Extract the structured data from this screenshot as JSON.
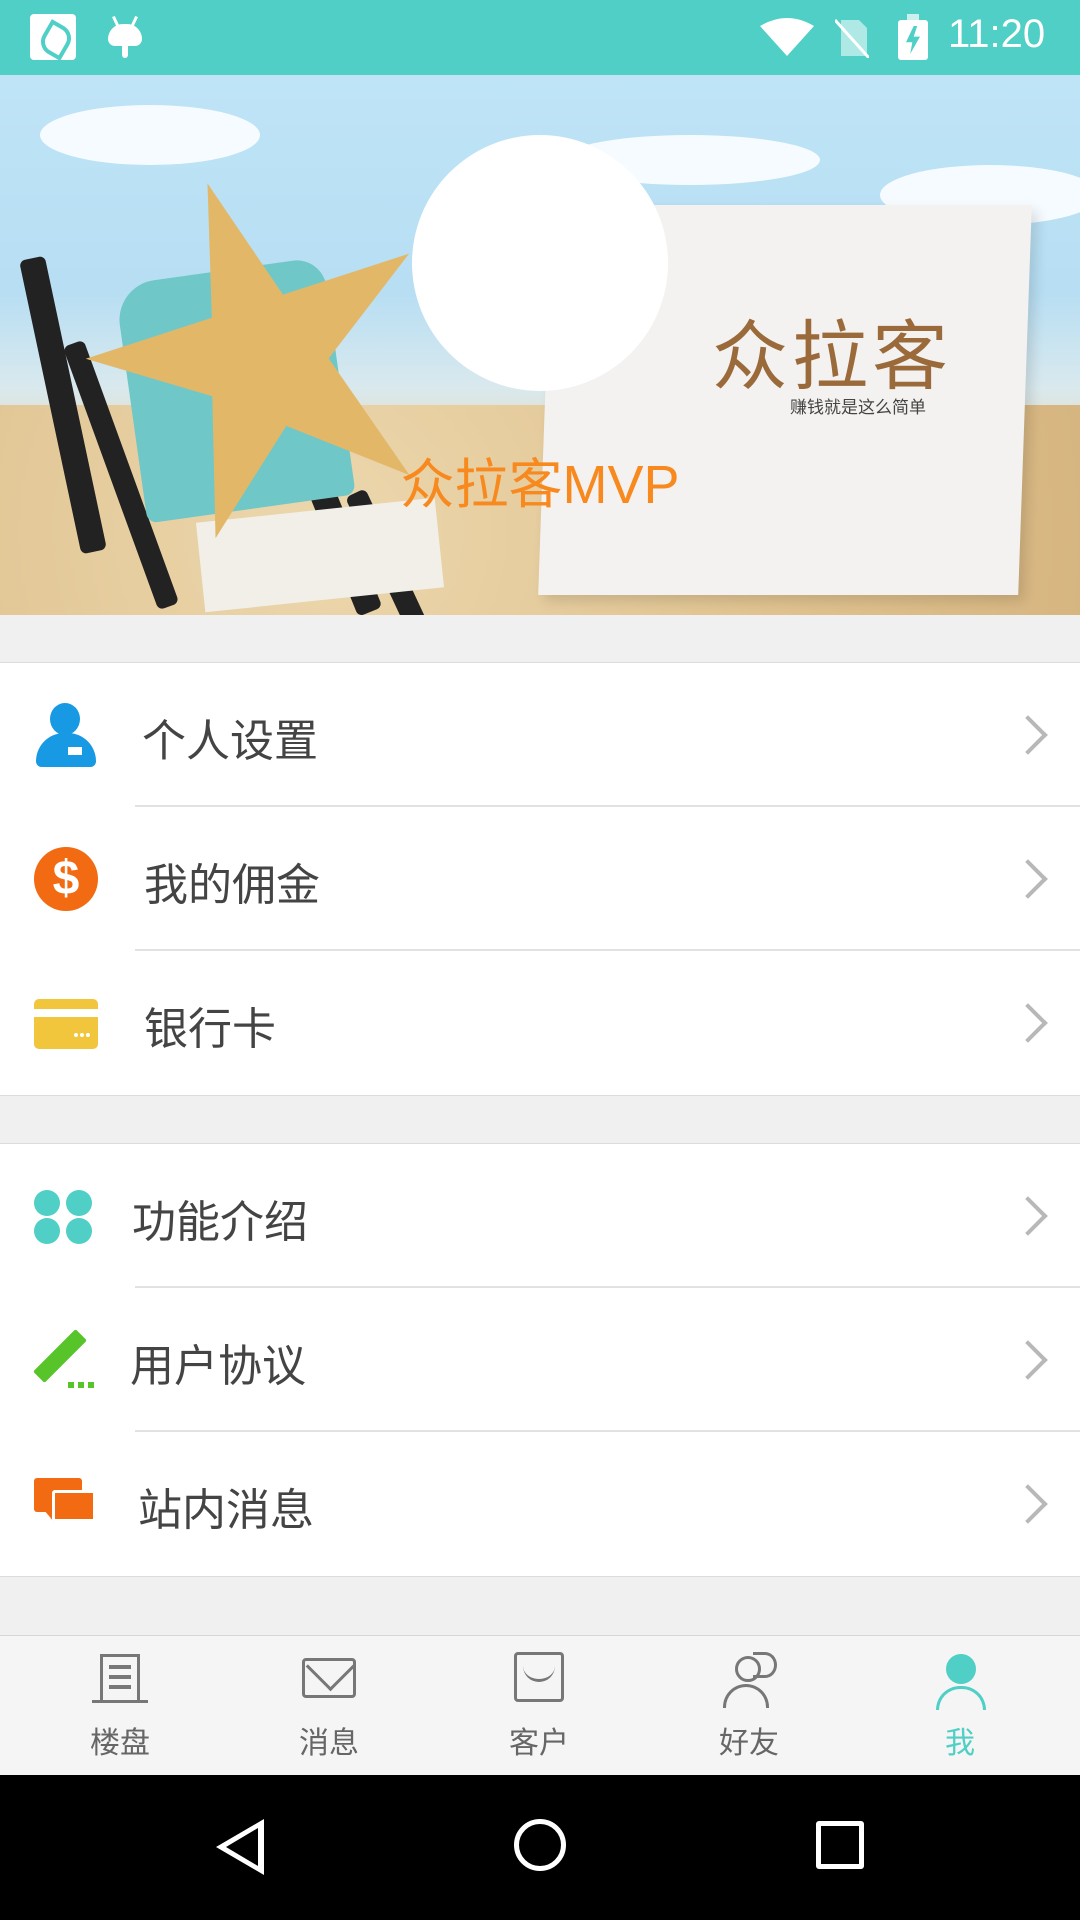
{
  "status_bar": {
    "time": "11:20",
    "icons": [
      "app-notification-icon",
      "android-debug-icon",
      "wifi-icon",
      "no-sim-icon",
      "battery-charging-icon"
    ]
  },
  "header": {
    "card_title": "众拉客",
    "card_subtitle": "赚钱就是这么简单",
    "app_name": "众拉客MVP"
  },
  "menu": {
    "group1": [
      {
        "label": "个人设置",
        "icon": "person-icon",
        "color": "#1899e4"
      },
      {
        "label": "我的佣金",
        "icon": "dollar-coin-icon",
        "color": "#f26b12"
      },
      {
        "label": "银行卡",
        "icon": "bank-card-icon",
        "color": "#f1c53c"
      }
    ],
    "group2": [
      {
        "label": "功能介绍",
        "icon": "grid-dots-icon",
        "color": "#4fcfc5"
      },
      {
        "label": "用户协议",
        "icon": "pencil-icon",
        "color": "#57c42a"
      },
      {
        "label": "站内消息",
        "icon": "chat-bubbles-icon",
        "color": "#f26b12"
      }
    ]
  },
  "tabs": [
    {
      "label": "楼盘",
      "icon": "building-icon"
    },
    {
      "label": "消息",
      "icon": "mail-icon"
    },
    {
      "label": "客户",
      "icon": "store-icon"
    },
    {
      "label": "好友",
      "icon": "friends-icon"
    },
    {
      "label": "我",
      "icon": "person-icon",
      "active": true
    }
  ],
  "colors": {
    "accent": "#4fcfc5",
    "app_name": "#f7891f"
  }
}
